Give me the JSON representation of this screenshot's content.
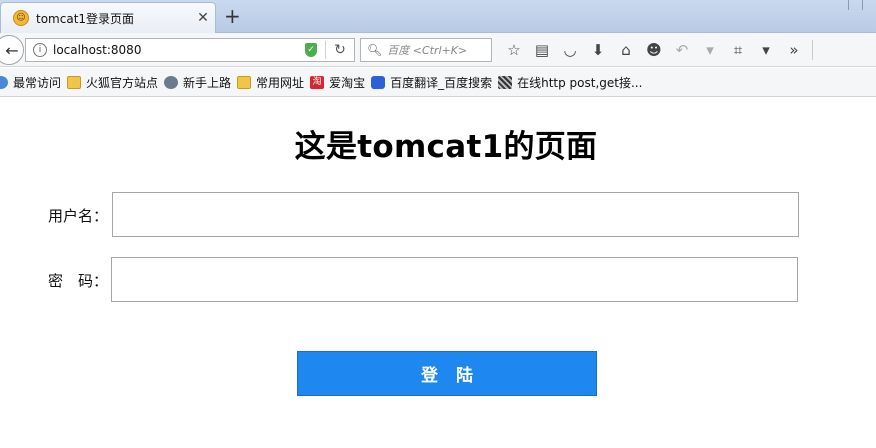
{
  "browser": {
    "tab_title": "tomcat1登录页面",
    "tab_close": "✕",
    "new_tab": "+",
    "url": "localhost:8080",
    "search_placeholder": "百度 <Ctrl+K>"
  },
  "bookmarks": [
    {
      "label": "最常访问",
      "icon": "star-icon"
    },
    {
      "label": "火狐官方站点",
      "icon": "folder-icon"
    },
    {
      "label": "新手上路",
      "icon": "globe-icon"
    },
    {
      "label": "常用网址",
      "icon": "folder-icon"
    },
    {
      "label": "爱淘宝",
      "icon": "taobao-icon"
    },
    {
      "label": "百度翻译_百度搜索",
      "icon": "baidu-icon"
    },
    {
      "label": "在线http post,get接...",
      "icon": "qr-icon"
    }
  ],
  "page": {
    "title": "这是tomcat1的页面",
    "username_label": "用户名：",
    "password_label": "密　码：",
    "username_value": "",
    "password_value": "",
    "login_label": "登陆"
  },
  "colors": {
    "login_button": "#1e88f0",
    "tab_strip": "#c9d9ee"
  }
}
